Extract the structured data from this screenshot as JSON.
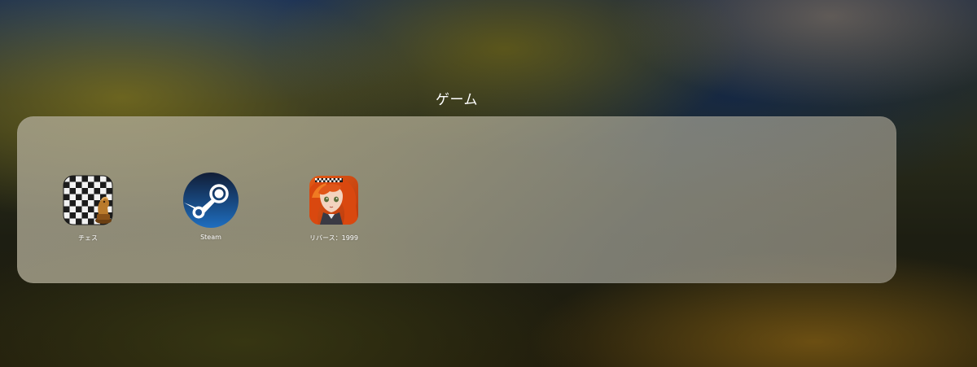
{
  "folder": {
    "title": "ゲーム",
    "apps": [
      {
        "label": "チェス",
        "icon": "chess-icon"
      },
      {
        "label": "Steam",
        "icon": "steam-icon"
      },
      {
        "label": "リバース：1999",
        "icon": "reverse-1999-icon"
      }
    ]
  },
  "colors": {
    "label": "#ffffff",
    "steam_bg": "#1b3a6b"
  }
}
